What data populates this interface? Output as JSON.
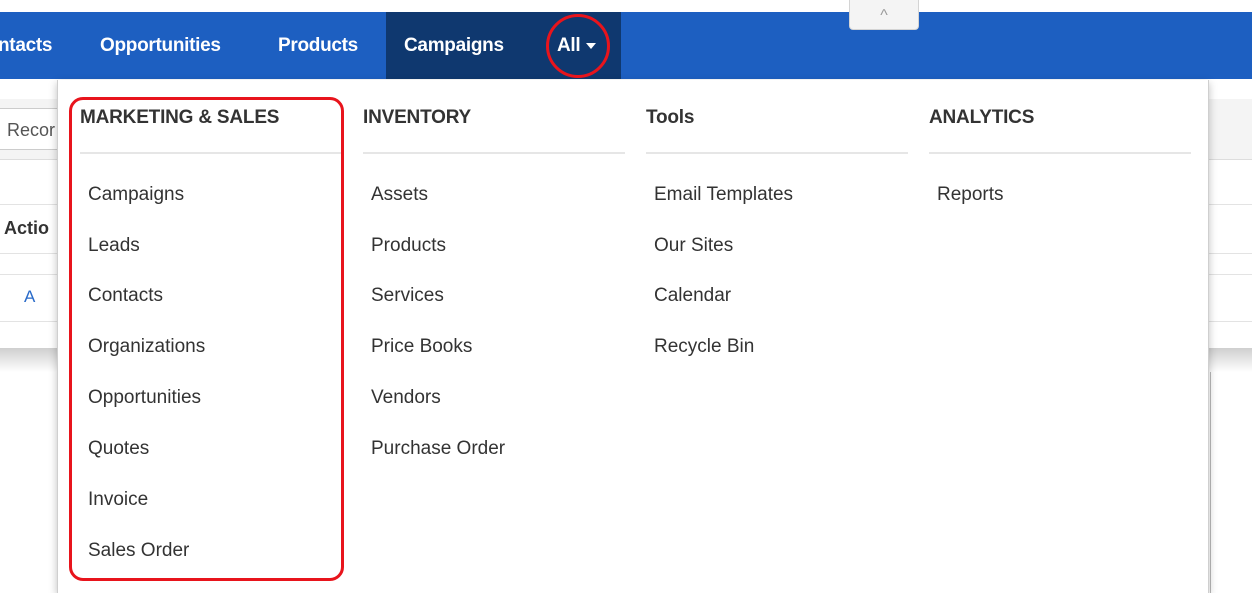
{
  "navbar": {
    "items": [
      {
        "label": "ntacts"
      },
      {
        "label": "Opportunities"
      },
      {
        "label": "Products"
      },
      {
        "label": "Campaigns"
      },
      {
        "label": "All"
      }
    ],
    "collapse_icon": "chevron-up-icon"
  },
  "background": {
    "button_label": "Recor",
    "header_label": "Actio",
    "row_label": "A"
  },
  "menu": {
    "columns": [
      {
        "heading": "MARKETING & SALES",
        "items": [
          "Campaigns",
          "Leads",
          "Contacts",
          "Organizations",
          "Opportunities",
          "Quotes",
          "Invoice",
          "Sales Order"
        ]
      },
      {
        "heading": "INVENTORY",
        "items": [
          "Assets",
          "Products",
          "Services",
          "Price Books",
          "Vendors",
          "Purchase Order"
        ]
      },
      {
        "heading": "Tools",
        "items": [
          "Email Templates",
          "Our Sites",
          "Calendar",
          "Recycle Bin"
        ]
      },
      {
        "heading": "ANALYTICS",
        "items": [
          "Reports"
        ]
      }
    ]
  },
  "colors": {
    "navbar": "#1d5fc1",
    "navbar_active": "#0f386f",
    "annotation": "#e8141c"
  }
}
